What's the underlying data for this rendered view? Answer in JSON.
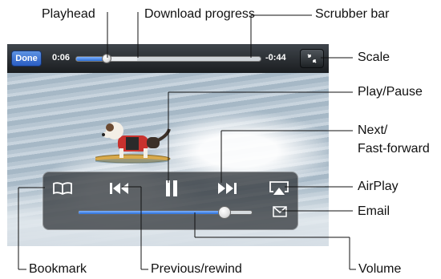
{
  "callouts": {
    "playhead": "Playhead",
    "download_progress": "Download progress",
    "scrubber_bar": "Scrubber bar",
    "scale": "Scale",
    "play_pause": "Play/Pause",
    "next_fast_forward_1": "Next/",
    "next_fast_forward_2": "Fast-forward",
    "airplay": "AirPlay",
    "email": "Email",
    "bookmark": "Bookmark",
    "previous_rewind": "Previous/rewind",
    "volume": "Volume"
  },
  "player": {
    "done_label": "Done",
    "elapsed": "0:06",
    "remaining": "-0:44",
    "playhead_fraction": 0.17,
    "download_fraction": 0.33,
    "volume_fraction": 0.84
  },
  "icons": {
    "bookmark": "bookmark-icon",
    "previous": "previous-rewind-icon",
    "play_pause": "pause-icon",
    "next": "next-fast-forward-icon",
    "airplay": "airplay-icon",
    "email": "email-icon",
    "scale": "scale-icon"
  },
  "colors": {
    "accent_blue": "#2c6fd6",
    "bar_dark": "#1a1d20"
  }
}
